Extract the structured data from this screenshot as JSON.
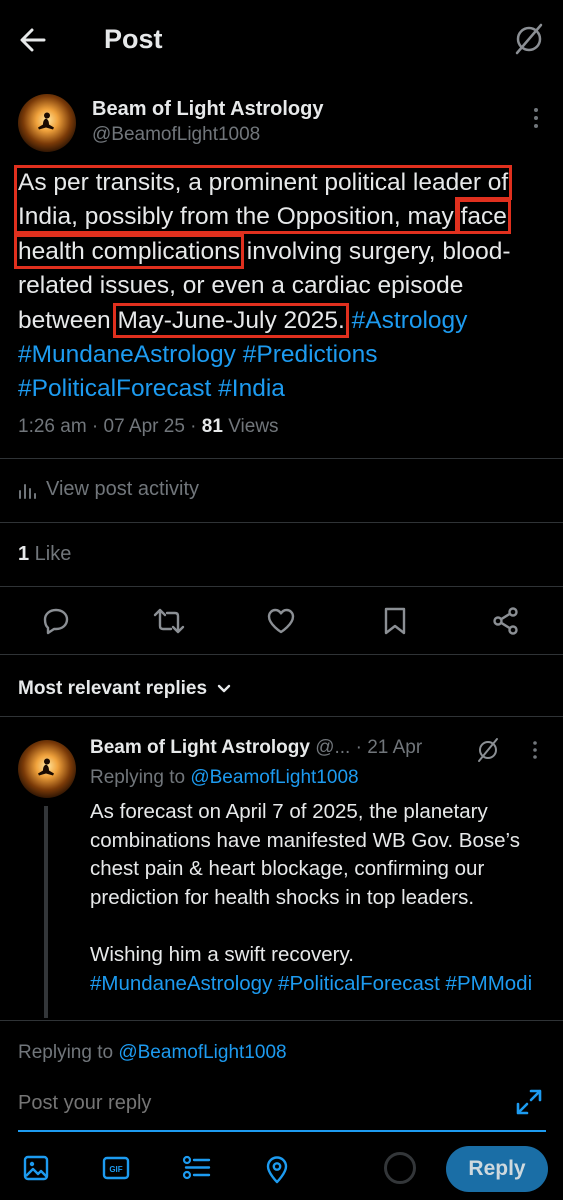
{
  "header": {
    "title": "Post"
  },
  "post": {
    "author_name": "Beam of Light Astrology",
    "author_handle": "@BeamofLight1008",
    "body": {
      "seg1": "As per transits, a prominent political leader of India, possibly from the Opposition, may",
      "seg2": "face health complications",
      "seg3": " involving surgery, blood-related issues, or even a cardiac episode between ",
      "seg4": "May-June-July 2025.",
      "hashtags": [
        "#Astrology",
        "#MundaneAstrology",
        "#Predictions",
        "#PoliticalForecast",
        "#India"
      ]
    },
    "time": "1:26 am",
    "date": "07 Apr 25",
    "views_count": "81",
    "views_label": " Views",
    "view_activity": "View post activity",
    "likes_count": "1",
    "likes_label": " Like"
  },
  "replies_header": "Most relevant replies",
  "reply": {
    "author_name": "Beam of Light Astrology",
    "handle_trunc": "@...",
    "date": "21 Apr",
    "replying_prefix": "Replying to ",
    "replying_handle": "@BeamofLight1008",
    "body": "As forecast on April 7 of 2025, the planetary combinations have manifested WB Gov. Bose’s chest pain & heart blockage, confirming our prediction for health shocks in top leaders.",
    "wish": "Wishing him a swift recovery.",
    "hashtags": [
      "#MundaneAstrology",
      "#PoliticalForecast",
      "#PMModi"
    ]
  },
  "composer": {
    "replying_prefix": "Replying to ",
    "replying_handle": "@BeamofLight1008",
    "placeholder": "Post your reply",
    "reply_button": "Reply"
  },
  "colors": {
    "accent": "#1d9bf0",
    "highlight_box": "#e0301e",
    "background": "#000000",
    "muted": "#71767b"
  }
}
